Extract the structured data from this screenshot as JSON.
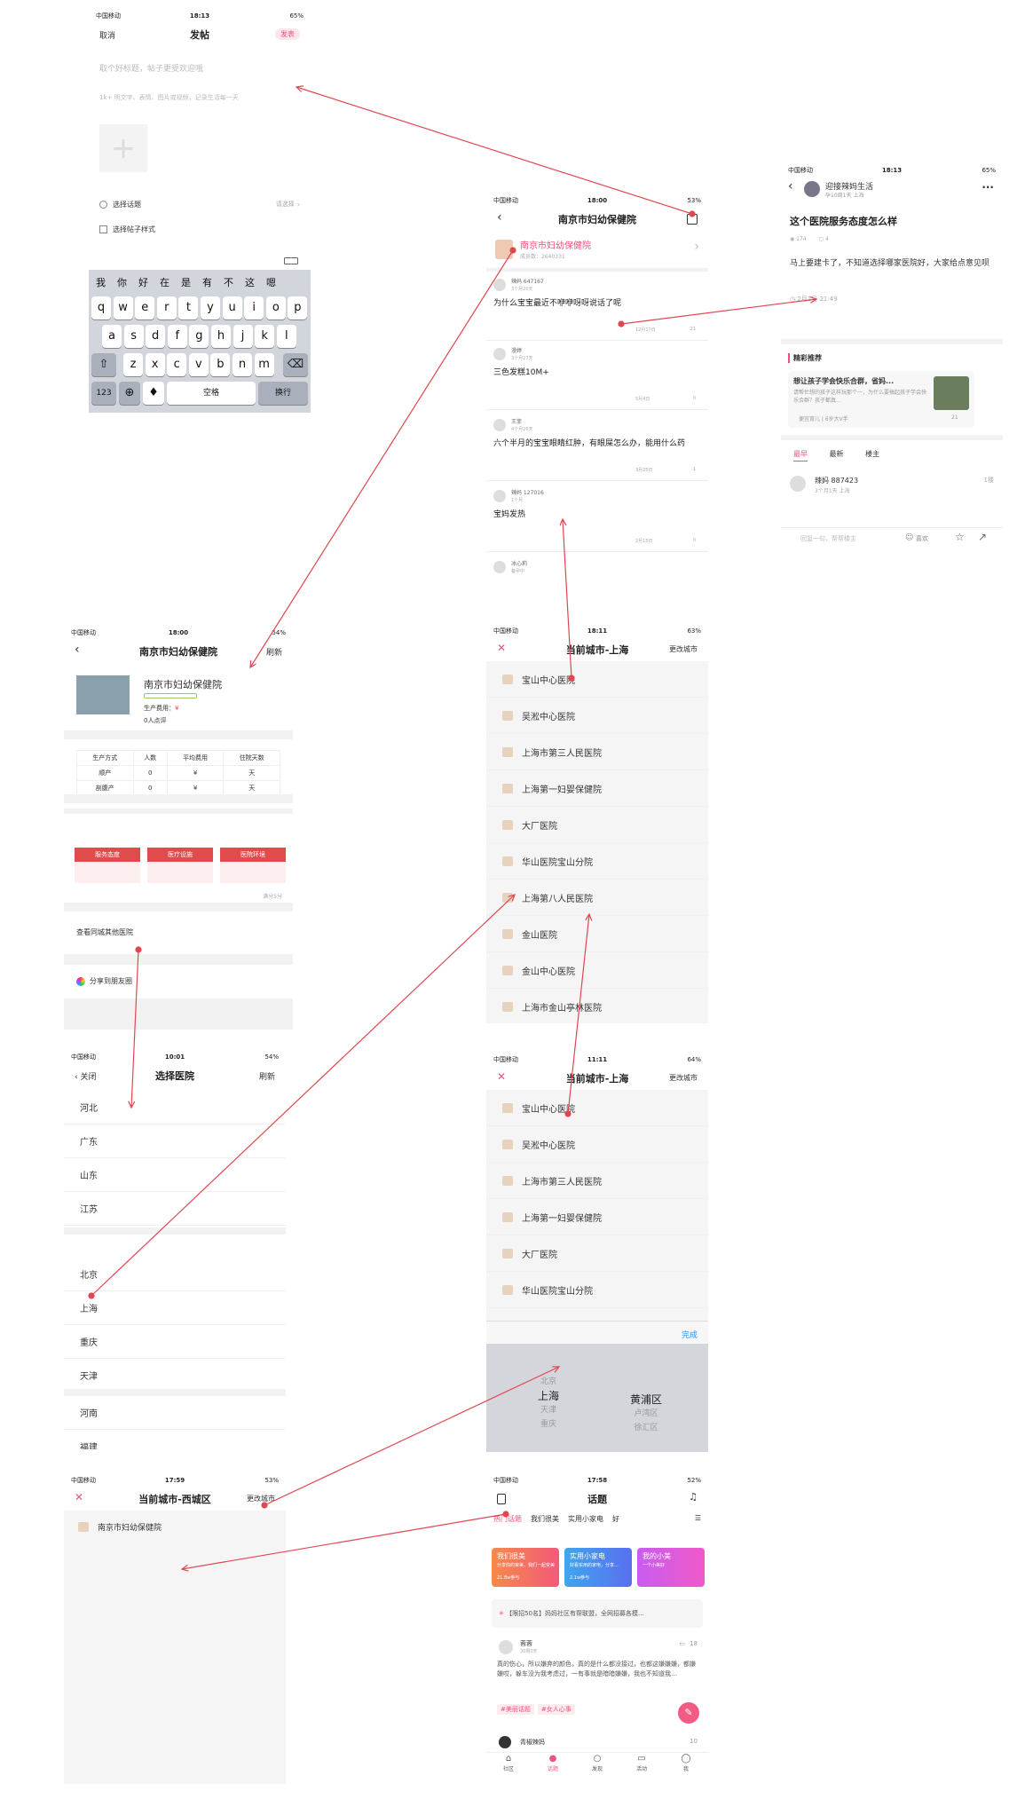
{
  "colors": {
    "accent": "#e9547a",
    "arrow": "#e0474f",
    "red": "#e04b4b"
  },
  "s1": {
    "status": {
      "carrier": "中国移动",
      "time": "18:13",
      "battery": "65%"
    },
    "nav": {
      "cancel": "取消",
      "title": "发帖",
      "publish": "发表"
    },
    "title_placeholder": "取个好标题，帖子更受欢迎哦",
    "body_placeholder": "1k+ 明文字、表情、图片或视频，记录生活每一天",
    "choose_topic": "选择话题",
    "choose_hint": "请选择",
    "choose_style": "选择帖子样式",
    "kb_row0": [
      "我",
      "你",
      "好",
      "在",
      "是",
      "有",
      "不",
      "这",
      "嗯"
    ],
    "kb_row1": [
      "q",
      "w",
      "e",
      "r",
      "t",
      "y",
      "u",
      "i",
      "o",
      "p"
    ],
    "kb_row2": [
      "a",
      "s",
      "d",
      "f",
      "g",
      "h",
      "j",
      "k",
      "l"
    ],
    "kb_row3": [
      "z",
      "x",
      "c",
      "v",
      "b",
      "n",
      "m"
    ],
    "kb_123": "123",
    "kb_space": "空格",
    "kb_return": "换行"
  },
  "s2": {
    "status": {
      "carrier": "中国移动",
      "time": "18:00",
      "battery": "53%"
    },
    "title": "南京市妇幼保健院",
    "hosp_name": "南京市妇幼保健院",
    "hosp_sub": "成员数：2640331",
    "posts": [
      {
        "user": "辣妈 647167",
        "time": "3个月20天",
        "text": "为什么宝宝最近不咿咿呀呀说话了呢",
        "date": "12月17日",
        "cnt": "21"
      },
      {
        "user": "漫婷",
        "time": "3个月27天",
        "text": "三色发糕10M+",
        "date": "5月4日",
        "cnt": "0"
      },
      {
        "user": "王菲",
        "time": "4个月26天",
        "text": "六个半月的宝宝眼睛红肿，有眼屎怎么办，能用什么药",
        "date": "3月25日",
        "cnt": "1"
      },
      {
        "user": "辣妈 127016",
        "time": "1个月",
        "text": "宝妈发热",
        "date": "2月15日",
        "cnt": "0"
      },
      {
        "user": "冰心莉",
        "time": "备孕中",
        "text": "",
        "date": "",
        "cnt": ""
      }
    ]
  },
  "s3": {
    "status": {
      "carrier": "中国移动",
      "time": "18:13",
      "battery": "65%"
    },
    "author": "迎接辣妈生活",
    "author_sub": "孕10周1天 上海",
    "title": "这个医院服务态度怎么样",
    "views": "174",
    "likes": "4",
    "body": "马上要建卡了，不知道选择哪家医院好，大家给点意见呗",
    "date": "2月1日 21:49",
    "rec_title": "精彩推荐",
    "rec_card": "想让孩子学会快乐合群，省妈...",
    "rec_text": "请帮忙想的孩子这样玩那个一，为什么要搞起孩子学会快乐合群？孩子都真...",
    "rec_user": "便宜育儿 | 6岁大V手",
    "rec_cnt": "21",
    "tabs": [
      "最早",
      "最新",
      "楼主"
    ],
    "reply_user": "辣妈 887423",
    "reply_sub": "3个月1天 上海",
    "reply_floor": "1楼",
    "input_hint": "回复一句，帮帮楼主",
    "emoji_label": "喜欢"
  },
  "s4": {
    "status": {
      "carrier": "中国移动",
      "time": "18:00",
      "battery": "54%"
    },
    "title": "南京市妇幼保健院",
    "refresh": "刷新",
    "name": "南京市妇幼保健院",
    "fee_label": "生产费用：",
    "fee_val": "¥",
    "reviews": "0人点评",
    "table_head": [
      "生产方式",
      "人数",
      "平均费用",
      "住院天数"
    ],
    "table_rows": [
      [
        "顺产",
        "0",
        "¥",
        "天"
      ],
      [
        "剖腹产",
        "0",
        "¥",
        "天"
      ]
    ],
    "btns": [
      "服务态度",
      "医疗设施",
      "医院环境"
    ],
    "score_note": "满分5分",
    "others": "查看同城其他医院",
    "share": "分享到朋友圈"
  },
  "s5": {
    "status": {
      "carrier": "中国移动",
      "time": "18:11",
      "battery": "63%"
    },
    "title": "当前城市-上海",
    "change": "更改城市",
    "hospitals": [
      "宝山中心医院",
      "吴淞中心医院",
      "上海市第三人民医院",
      "上海第一妇婴保健院",
      "大厂医院",
      "华山医院宝山分院",
      "上海第八人民医院",
      "金山医院",
      "金山中心医院",
      "上海市金山亭林医院"
    ]
  },
  "s6": {
    "status": {
      "carrier": "中国移动",
      "time": "10:01",
      "battery": "54%"
    },
    "close": "关闭",
    "title": "选择医院",
    "refresh": "刷新",
    "group1": [
      "河北",
      "广东",
      "山东",
      "江苏"
    ],
    "group2": [
      "北京",
      "上海",
      "重庆",
      "天津"
    ],
    "group3": [
      "河南",
      "福建"
    ]
  },
  "s7": {
    "status": {
      "carrier": "中国移动",
      "time": "11:11",
      "battery": "64%"
    },
    "title": "当前城市-上海",
    "change": "更改城市",
    "hospitals": [
      "宝山中心医院",
      "吴淞中心医院",
      "上海市第三人民医院",
      "上海第一妇婴保健院",
      "大厂医院",
      "华山医院宝山分院"
    ],
    "done": "完成",
    "picker_left": [
      "北京",
      "上海",
      "天津",
      "重庆"
    ],
    "picker_right": [
      "黄浦区",
      "卢湾区",
      "徐汇区"
    ]
  },
  "s8": {
    "status": {
      "carrier": "中国移动",
      "time": "17:59",
      "battery": "53%"
    },
    "title": "当前城市-西城区",
    "change": "更改城市",
    "hospital": "南京市妇幼保健院"
  },
  "s9": {
    "status": {
      "carrier": "中国移动",
      "time": "17:58",
      "battery": "52%"
    },
    "title": "话题",
    "tabs": [
      "热门话题",
      "我们很美",
      "实用小家电",
      "好"
    ],
    "cards": [
      {
        "title": "我们很美",
        "sub": "分享你的审美，我们一起变美",
        "cnt": "21.8w参与"
      },
      {
        "title": "实用小家电",
        "sub": "好看实用的家电，分享...",
        "cnt": "2.1w参与"
      },
      {
        "title": "我的小美",
        "sub": "一个小美好",
        "cnt": ""
      }
    ],
    "notice": "【限招50名】妈妈社区有帮联盟，全网招募各模...",
    "post_user": "蓉蓉",
    "post_time": "30周0天",
    "post_cnt": "18",
    "post_text": "真的伤心，所以嫌弃的颜色，真的是什么都没接过，也都这嫌嫌嫌，都嫌嫌哎，躲车没为我考虑过，一有事就是暗暗嫌嫌，我也不知道我…",
    "post_tags": [
      "#美丽话题",
      "#女人心事"
    ],
    "post2_user": "青椒辣妈",
    "post2_cnt": "10",
    "bottom": [
      "社区",
      "话题",
      "发现",
      "活动",
      "我"
    ]
  }
}
